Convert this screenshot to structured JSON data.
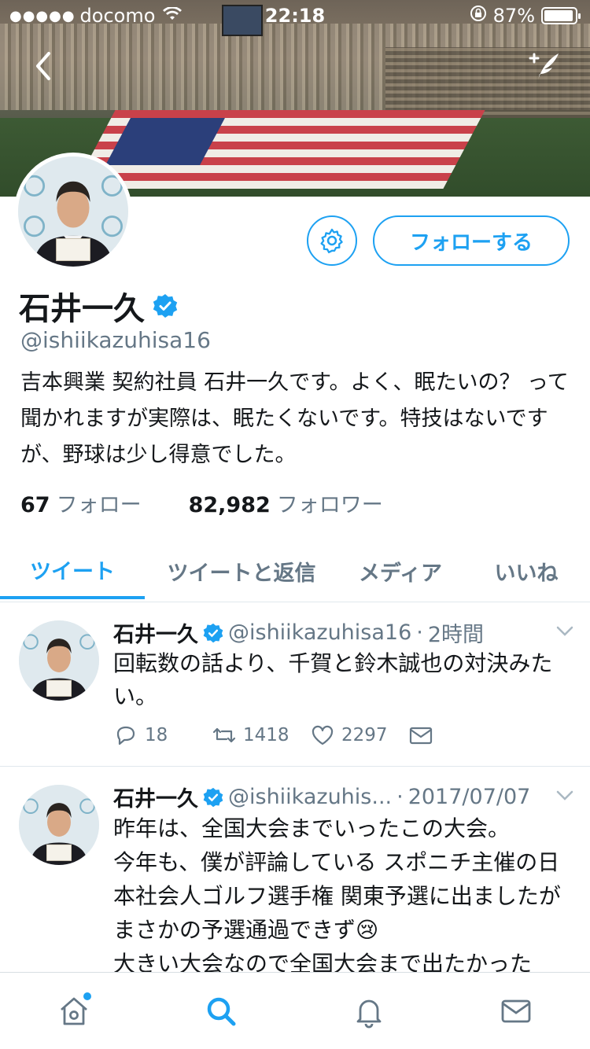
{
  "status_bar": {
    "signal": "●●●●●",
    "carrier": "docomo",
    "time": "22:18",
    "battery": "87%"
  },
  "profile": {
    "name": "石井一久",
    "handle": "@ishiikazuhisa16",
    "bio": "吉本興業 契約社員 石井一久です。よく、眠たいの？ って聞かれますが実際は、眠たくないです。特技はないですが、野球は少し得意でした。",
    "following_count": "67",
    "following_label": "フォロー",
    "followers_count": "82,982",
    "followers_label": "フォロワー",
    "follow_button": "フォローする"
  },
  "tabs": [
    {
      "label": "ツイート",
      "active": true
    },
    {
      "label": "ツイートと返信",
      "active": false
    },
    {
      "label": "メディア",
      "active": false
    },
    {
      "label": "いいね",
      "active": false
    }
  ],
  "tweets": [
    {
      "name": "石井一久",
      "handle": "@ishiikazuhisa16",
      "time": "2時間",
      "text": "回転数の話より、千賀と鈴木誠也の対決みたい。",
      "replies": "18",
      "retweets": "1418",
      "likes": "2297"
    },
    {
      "name": "石井一久",
      "handle": "@ishiikazuhis...",
      "time": "2017/07/07",
      "text": "昨年は、全国大会までいったこの大会。\n今年も、僕が評論している スポニチ主催の日本社会人ゴルフ選手権 関東予選に出ましたが まさかの予選通過できず😢\n大きい大会なので全国大会まで出たかった"
    }
  ],
  "colors": {
    "accent": "#1da1f2",
    "muted": "#657786",
    "text": "#14171a"
  },
  "icons": {
    "nav": [
      "home-icon",
      "search-icon",
      "notifications-icon",
      "messages-icon"
    ]
  }
}
